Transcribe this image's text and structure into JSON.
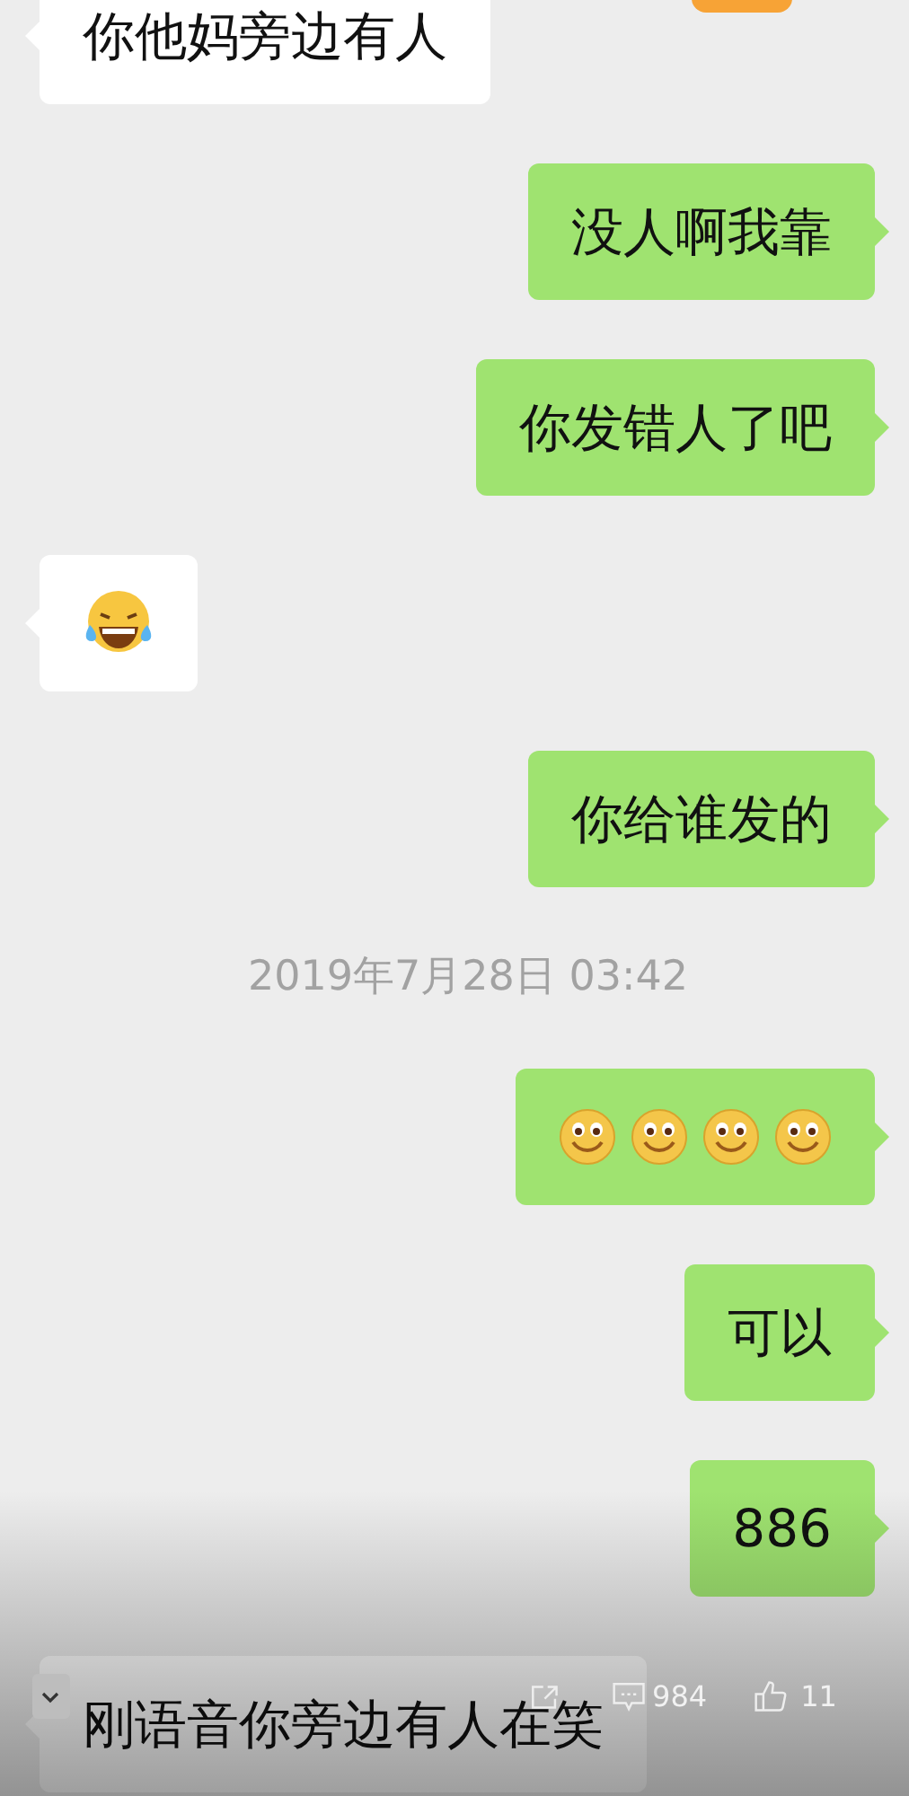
{
  "messages": [
    {
      "outgoing": false,
      "kind": "text",
      "text": "你他妈旁边有人"
    },
    {
      "outgoing": true,
      "kind": "text",
      "text": "没人啊我靠"
    },
    {
      "outgoing": true,
      "kind": "text",
      "text": "你发错人了吧"
    },
    {
      "outgoing": false,
      "kind": "emoji",
      "emojis": [
        {
          "kind": "laugh"
        }
      ]
    },
    {
      "outgoing": true,
      "kind": "text",
      "text": "你给谁发的"
    },
    {
      "kind": "timestamp",
      "text": "2019年7月28日 03:42"
    },
    {
      "outgoing": true,
      "kind": "emoji",
      "emojis": [
        {
          "kind": "smile"
        },
        {
          "kind": "smile"
        },
        {
          "kind": "smile"
        },
        {
          "kind": "smile"
        }
      ]
    },
    {
      "outgoing": true,
      "kind": "text",
      "text": "可以"
    },
    {
      "outgoing": true,
      "kind": "text",
      "text": "886"
    },
    {
      "outgoing": false,
      "kind": "text",
      "text": "刚语音你旁边有人在笑"
    }
  ],
  "toolbar": {
    "comments": "984",
    "likes": "11"
  }
}
